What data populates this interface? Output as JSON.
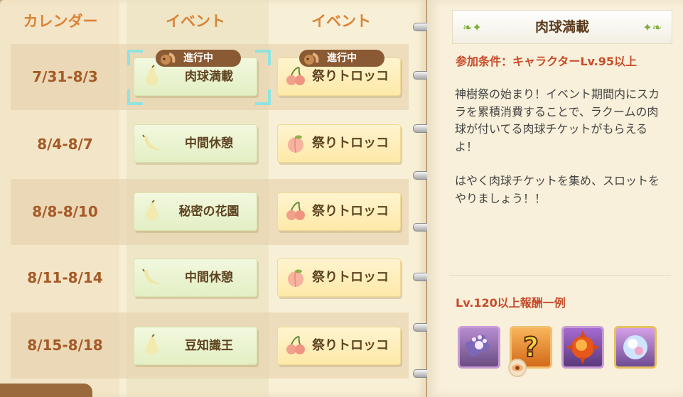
{
  "header": {
    "calendar_label": "カレンダー",
    "event1_label": "イベント",
    "event2_label": "イベント"
  },
  "rows": [
    {
      "date": "7/31-8/3",
      "event1": {
        "label": "肉球満載",
        "fruit": "pear-icon",
        "badge": "進行中"
      },
      "event2": {
        "label": "祭りトロッコ",
        "fruit": "cherry-icon",
        "badge": "進行中"
      }
    },
    {
      "date": "8/4-8/7",
      "event1": {
        "label": "中間休憩",
        "fruit": "banana-icon"
      },
      "event2": {
        "label": "祭りトロッコ",
        "fruit": "peach-icon"
      }
    },
    {
      "date": "8/8-8/10",
      "event1": {
        "label": "秘密の花園",
        "fruit": "pear-icon"
      },
      "event2": {
        "label": "祭りトロッコ",
        "fruit": "cherry-icon"
      }
    },
    {
      "date": "8/11-8/14",
      "event1": {
        "label": "中間休憩",
        "fruit": "banana-icon"
      },
      "event2": {
        "label": "祭りトロッコ",
        "fruit": "peach-icon"
      }
    },
    {
      "date": "8/15-8/18",
      "event1": {
        "label": "豆知識王",
        "fruit": "pear-icon"
      },
      "event2": {
        "label": "祭りトロッコ",
        "fruit": "cherry-icon"
      }
    }
  ],
  "detail": {
    "title": "肉球満載",
    "condition": "参加条件：キャラクターLv.95以上",
    "desc1": "神樹祭の始まり！イベント期間内にスカラを累積消費することで、ラクームの肉球が付いてる肉球チケットがもらえるよ！",
    "desc2": "はやく肉球チケットを集め、スロットをやりましょう！！",
    "reward_title": "Lv.120以上報酬一例",
    "rewards": [
      "paw-ticket-icon",
      "question-mark-icon",
      "fire-orb-icon",
      "crystal-orb-icon"
    ]
  },
  "colors": {
    "header_text": "#d98436",
    "date_text": "#a45a26",
    "accent_red": "#c84b2b",
    "badge_bg": "#8a5a34",
    "selection": "#8fe3e0"
  }
}
